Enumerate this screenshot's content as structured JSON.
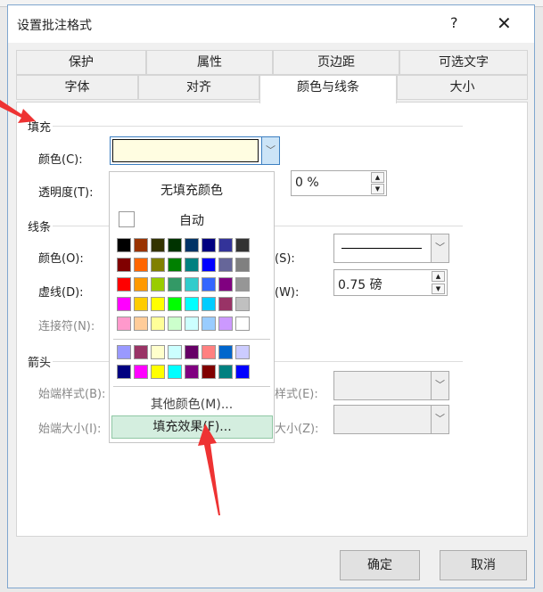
{
  "dialog": {
    "title": "设置批注格式",
    "help": "?",
    "close": "✕"
  },
  "tabs_row1": [
    "保护",
    "属性",
    "页边距",
    "可选文字"
  ],
  "tabs_row2": [
    "字体",
    "对齐",
    "颜色与线条",
    "大小"
  ],
  "fill": {
    "section": "填充",
    "color_label": "颜色(C):",
    "color_value": "#fffde1",
    "transparency_label": "透明度(T):",
    "transparency_value": "0 %"
  },
  "line": {
    "section": "线条",
    "color_label": "颜色(O):",
    "style_label": "样式(S):",
    "dash_label": "虚线(D):",
    "weight_label": "粗细(W):",
    "weight_value": "0.75 磅",
    "connector_label": "连接符(N):"
  },
  "arrows": {
    "section": "箭头",
    "begin_style_label": "始端样式(B):",
    "end_style_label": "末端样式(E):",
    "begin_size_label": "始端大小(I):",
    "end_size_label": "末端大小(Z):"
  },
  "popup": {
    "no_fill": "无填充颜色",
    "auto": "自动",
    "more_colors": "其他颜色(M)...",
    "fill_effects": "填充效果(F)...",
    "standard_colors": [
      "#000000",
      "#993300",
      "#333300",
      "#003300",
      "#003366",
      "#000080",
      "#333399",
      "#333333",
      "#800000",
      "#ff6600",
      "#808000",
      "#008000",
      "#008080",
      "#0000ff",
      "#666699",
      "#808080",
      "#ff0000",
      "#ff9900",
      "#99cc00",
      "#339966",
      "#33cccc",
      "#3366ff",
      "#800080",
      "#969696",
      "#ff00ff",
      "#ffcc00",
      "#ffff00",
      "#00ff00",
      "#00ffff",
      "#00ccff",
      "#993366",
      "#c0c0c0",
      "#ff99cc",
      "#ffcc99",
      "#ffff99",
      "#ccffcc",
      "#ccffff",
      "#99ccff",
      "#cc99ff",
      "#ffffff"
    ],
    "extra_colors": [
      "#9999ff",
      "#993366",
      "#ffffcc",
      "#ccffff",
      "#660066",
      "#ff8080",
      "#0066cc",
      "#ccccff",
      "#000080",
      "#ff00ff",
      "#ffff00",
      "#00ffff",
      "#800080",
      "#800000",
      "#008080",
      "#0000ff"
    ]
  },
  "buttons": {
    "ok": "确定",
    "cancel": "取消"
  },
  "accent": "#ee3333"
}
